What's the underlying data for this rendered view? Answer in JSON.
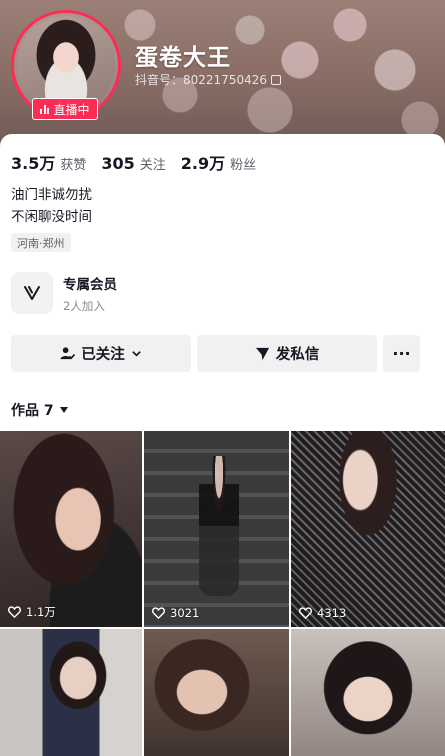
{
  "profile": {
    "nickname": "蛋卷大王",
    "douyin_id": "抖音号：80221750426",
    "live_label": "直播中",
    "accent_color": "#fe2c55"
  },
  "stats": [
    {
      "value": "3.5万",
      "label": "获赞"
    },
    {
      "value": "305",
      "label": "关注"
    },
    {
      "value": "2.9万",
      "label": "粉丝"
    }
  ],
  "bio": {
    "line1": "油门非诚勿扰",
    "line2": "不闲聊没时间"
  },
  "location": "河南·郑州",
  "member": {
    "title": "专属会员",
    "subtitle": "2人加入"
  },
  "actions": {
    "follow_label": "已关注",
    "message_label": "发私信",
    "more_label": "···"
  },
  "works": {
    "tab_label": "作品 7",
    "items": [
      {
        "likes": "1.1万"
      },
      {
        "likes": "3021"
      },
      {
        "likes": "4313"
      },
      {
        "likes": ""
      },
      {
        "likes": ""
      },
      {
        "likes": ""
      }
    ]
  }
}
